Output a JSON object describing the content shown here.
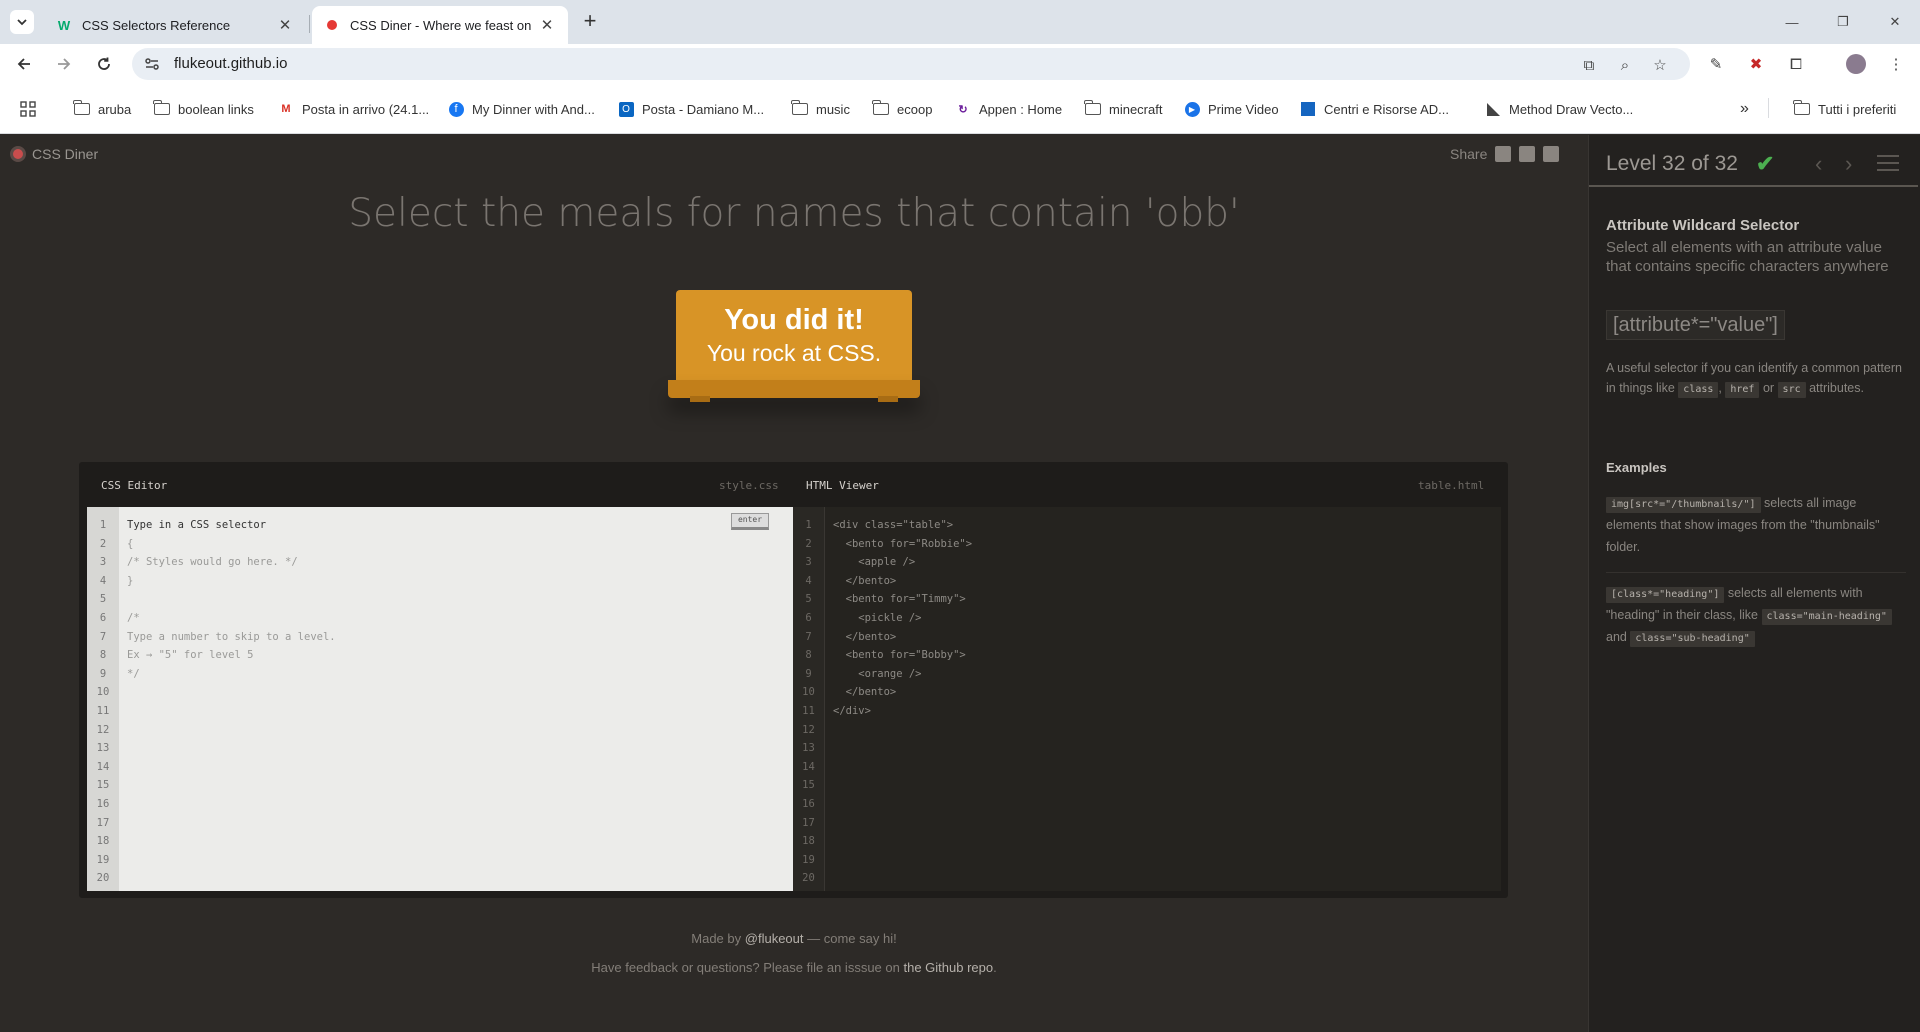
{
  "browser": {
    "tabs": [
      {
        "title": "CSS Selectors Reference",
        "icon": "w3schools-icon",
        "active": false
      },
      {
        "title": "CSS Diner - Where we feast on",
        "icon": "css-diner-icon",
        "active": true
      }
    ],
    "address": {
      "url": "flukeout.github.io"
    },
    "bookmarks": [
      {
        "label": "aruba",
        "icon": "folder-icon"
      },
      {
        "label": "boolean links",
        "icon": "folder-icon"
      },
      {
        "label": "Posta in arrivo (24.1...",
        "icon": "gmail-icon"
      },
      {
        "label": "My Dinner with And...",
        "icon": "facebook-icon"
      },
      {
        "label": "Posta - Damiano M...",
        "icon": "outlook-icon"
      },
      {
        "label": "music",
        "icon": "folder-icon"
      },
      {
        "label": "ecoop",
        "icon": "folder-icon"
      },
      {
        "label": "Appen : Home",
        "icon": "appen-icon"
      },
      {
        "label": "minecraft",
        "icon": "folder-icon"
      },
      {
        "label": "Prime Video",
        "icon": "prime-video-icon"
      },
      {
        "label": "Centri e Risorse AD...",
        "icon": "adobe-icon"
      },
      {
        "label": "Method Draw Vecto...",
        "icon": "method-draw-icon"
      }
    ],
    "other_bookmarks": "Tutti i preferiti",
    "more_bookmarks": "»"
  },
  "page": {
    "logo": "CSS Diner",
    "share_label": "Share",
    "order": "Select the meals for names that contain 'obb'",
    "win_line1": "You did it!",
    "win_line2": "You rock at CSS.",
    "css_editor": {
      "title": "CSS Editor",
      "file": "style.css",
      "enter": "enter",
      "lines": [
        "Type in a CSS selector",
        "{",
        "/* Styles would go here. */",
        "}",
        "",
        "/*",
        "Type a number to skip to a level.",
        "Ex → \"5\" for level 5",
        "*/"
      ],
      "line_numbers": [
        "1",
        "2",
        "3",
        "4",
        "5",
        "6",
        "7",
        "8",
        "9",
        "10",
        "11",
        "12",
        "13",
        "14",
        "15",
        "16",
        "17",
        "18",
        "19",
        "20"
      ]
    },
    "html_viewer": {
      "title": "HTML Viewer",
      "file": "table.html",
      "lines": [
        "<div class=\"table\">",
        "  <bento for=\"Robbie\">",
        "    <apple />",
        "  </bento>",
        "  <bento for=\"Timmy\">",
        "    <pickle />",
        "  </bento>",
        "  <bento for=\"Bobby\">",
        "    <orange />",
        "  </bento>",
        "</div>"
      ],
      "line_numbers": [
        "1",
        "2",
        "3",
        "4",
        "5",
        "6",
        "7",
        "8",
        "9",
        "10",
        "11",
        "12",
        "13",
        "14",
        "15",
        "16",
        "17",
        "18",
        "19",
        "20"
      ]
    },
    "footer": {
      "made_by_prefix": "Made by",
      "made_by_link": "@flukeout",
      "made_by_suffix": "— come say hi!",
      "feedback_prefix": "Have feedback or questions? Please file an isssue on",
      "feedback_link": "the Github repo",
      "feedback_suffix": "."
    }
  },
  "sidebar": {
    "level_label": "Level 32 of 32",
    "level_completed": true,
    "progress": 1.0,
    "selector_name": "Attribute Wildcard Selector",
    "selector_title": "Select all elements with an attribute value that contains specific characters anywhere",
    "syntax": "[attribute*=\"value\"]",
    "hint_prefix": "A useful selector if you can identify a common pattern in things like",
    "hint_tag1": "class",
    "hint_comma": ",",
    "hint_tag2": "href",
    "hint_or": "or",
    "hint_tag3": "src",
    "hint_suffix": "attributes.",
    "examples_title": "Examples",
    "example1_code": "img[src*=\"/thumbnails/\"]",
    "example1_text": "selects all image elements that show images from the \"thumbnails\" folder.",
    "example2_code": "[class*=\"heading\"]",
    "example2_text1": "selects all elements with \"heading\" in their class, like",
    "example2_code2": "class=\"main-heading\"",
    "example2_and": "and",
    "example2_code3": "class=\"sub-heading\""
  },
  "colors": {
    "page_bg": "#2d2a27",
    "table_orange": "#d89426",
    "success_green": "#4caf50"
  }
}
